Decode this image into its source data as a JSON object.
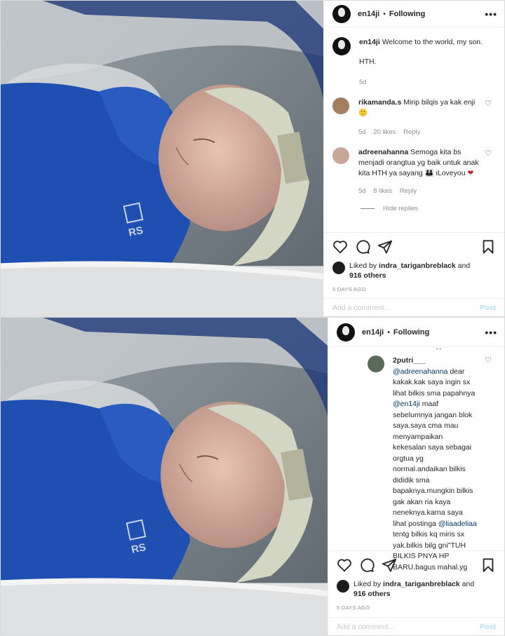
{
  "post": {
    "username": "en14ji",
    "follow_label": "Following",
    "more_label": "•••",
    "caption_line1": "Welcome to the world, my son.",
    "caption_line2": "HTH.",
    "caption_time": "5d",
    "photo_brand": "RS"
  },
  "comments": [
    {
      "username": "rikamanda.s",
      "text": "Mirip bilqis ya kak enji",
      "emoji": "🙂",
      "time": "5d",
      "likes": "20 likes",
      "reply": "Reply",
      "avatar_color": "#a08060"
    },
    {
      "username": "adreenahanna",
      "text": "Semoga kita bs menjadi orangtua yg baik untuk anak kita HTH ya sayang",
      "emoji": "👪",
      "text2": "iLoveyou",
      "emoji2": "❤",
      "time": "5d",
      "likes": "8 likes",
      "reply": "Reply",
      "hide_replies": "Hide replies",
      "avatar_color": "#c7a79a"
    }
  ],
  "reply_comment": {
    "username": "2putri___",
    "mention1": "@adreenahanna",
    "text1": "dear kakak.kak saya ingin sx lihat bilkis sma papahnya",
    "mention2": "@en14ji",
    "text2": "maaf sebelumnya jangan blok saya.saya cma mau menyampaikan kekesalan saya sebagai orgtua yg normal.andaikan bilkis dididik sma bapaknya.mungkin bilkis gak akan ria kaya neneknya.karna saya lihat postinga",
    "mention3": "@liaadeliaa",
    "text3": "tentg bilkis kq miris sx yak.bilkis bilg gni\"TUH BILKIS PNYA HP BARU.bagus mahal.yg",
    "avatar_color": "#5a6a5a"
  },
  "actions": {
    "liked_by_prefix": "Liked by",
    "liked_by_user": "indra_tariganbreblack",
    "and_label": "and",
    "others": "916 others",
    "time_ago": "5 DAYS AGO",
    "add_comment_placeholder": "Add a comment...",
    "post_label": "Post"
  },
  "icons": [
    "heart-icon",
    "comment-icon",
    "share-icon",
    "bookmark-icon"
  ],
  "colors": {
    "mention": "#00376b",
    "post_button": "#b2dffc",
    "meta_text": "#8e8e8e",
    "blanket": "#1f4fb0"
  }
}
